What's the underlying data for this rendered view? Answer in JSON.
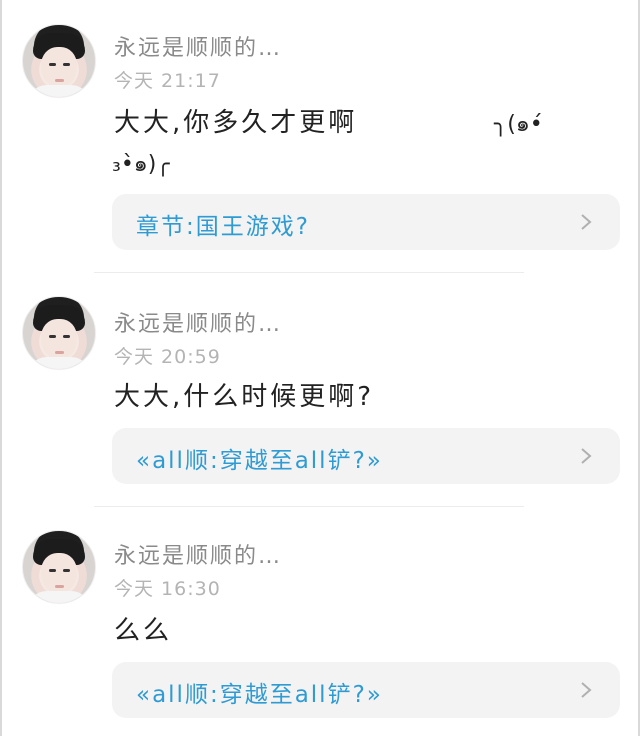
{
  "comments": [
    {
      "username": "永远是顺顺的…",
      "time": "今天 21:17",
      "message": "大大,你多久才更啊",
      "emoticon_part1": "╮(๑•́",
      "emoticon_part2": "₃•̀๑)╭",
      "card_label": "章节:国王游戏?",
      "card_icon": "chevron-right-icon"
    },
    {
      "username": "永远是顺顺的…",
      "time": "今天 20:59",
      "message": "大大,什么时候更啊?",
      "card_label": "«all顺:穿越至all铲?»",
      "card_icon": "chevron-right-icon"
    },
    {
      "username": "永远是顺顺的…",
      "time": "今天 16:30",
      "message": "么么",
      "card_label": "«all顺:穿越至all铲?»",
      "card_icon": "chevron-right-icon"
    }
  ],
  "colors": {
    "link": "#2f9bd3",
    "card_bg": "#f3f3f3",
    "name": "#8a8a8a",
    "time": "#b4b4b4"
  }
}
